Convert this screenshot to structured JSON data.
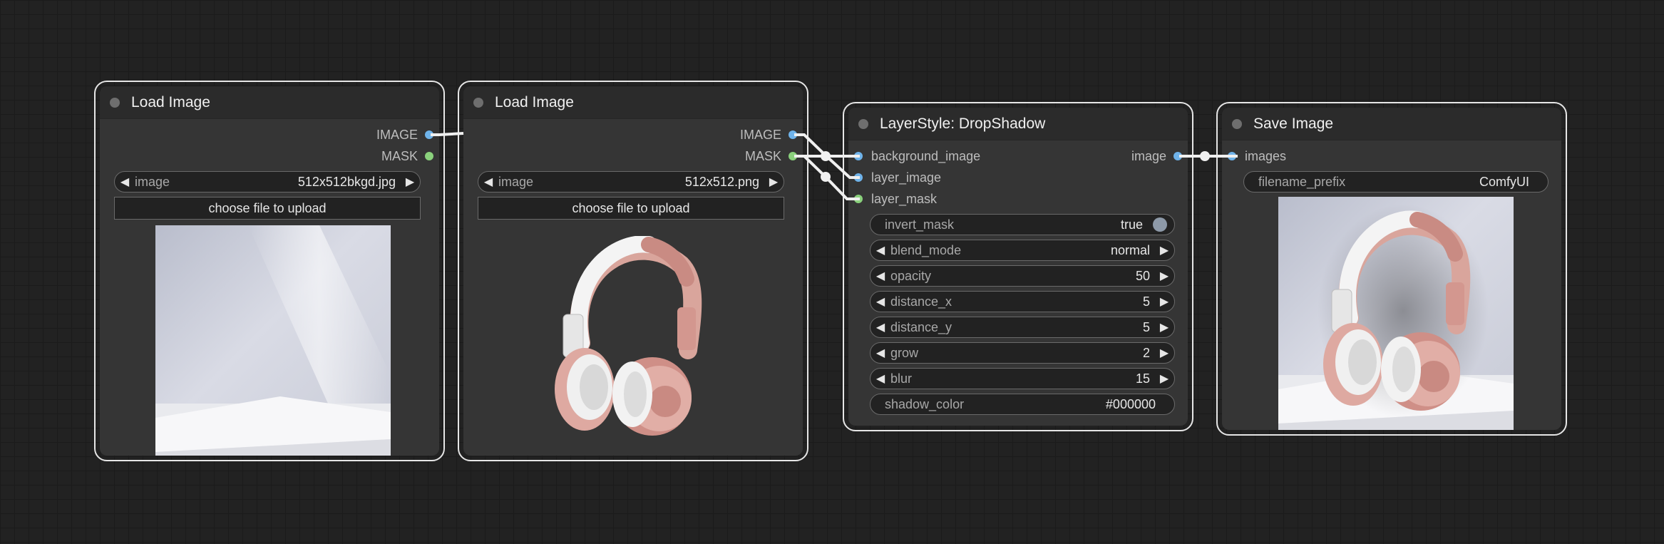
{
  "nodes": {
    "load1": {
      "title": "Load Image",
      "outputs": [
        "IMAGE",
        "MASK"
      ],
      "image_widget": {
        "label": "image",
        "value": "512x512bkgd.jpg"
      },
      "upload_label": "choose file to upload"
    },
    "load2": {
      "title": "Load Image",
      "outputs": [
        "IMAGE",
        "MASK"
      ],
      "image_widget": {
        "label": "image",
        "value": "512x512.png"
      },
      "upload_label": "choose file to upload"
    },
    "dropshadow": {
      "title": "LayerStyle: DropShadow",
      "inputs": [
        "background_image",
        "layer_image",
        "layer_mask"
      ],
      "output": "image",
      "widgets": [
        {
          "label": "invert_mask",
          "value": "true"
        },
        {
          "label": "blend_mode",
          "value": "normal"
        },
        {
          "label": "opacity",
          "value": "50"
        },
        {
          "label": "distance_x",
          "value": "5"
        },
        {
          "label": "distance_y",
          "value": "5"
        },
        {
          "label": "grow",
          "value": "2"
        },
        {
          "label": "blur",
          "value": "15"
        },
        {
          "label": "shadow_color",
          "value": "#000000"
        }
      ]
    },
    "save": {
      "title": "Save Image",
      "input": "images",
      "widget": {
        "label": "filename_prefix",
        "value": "ComfyUI"
      }
    }
  },
  "icons": {
    "left_arrow": "◀",
    "right_arrow": "▶"
  },
  "colors": {
    "canvas": "#222222",
    "node_body": "#353535",
    "image_slot": "#6fb3ea",
    "mask_slot": "#8ad17c",
    "link": "#f0f0f0"
  }
}
